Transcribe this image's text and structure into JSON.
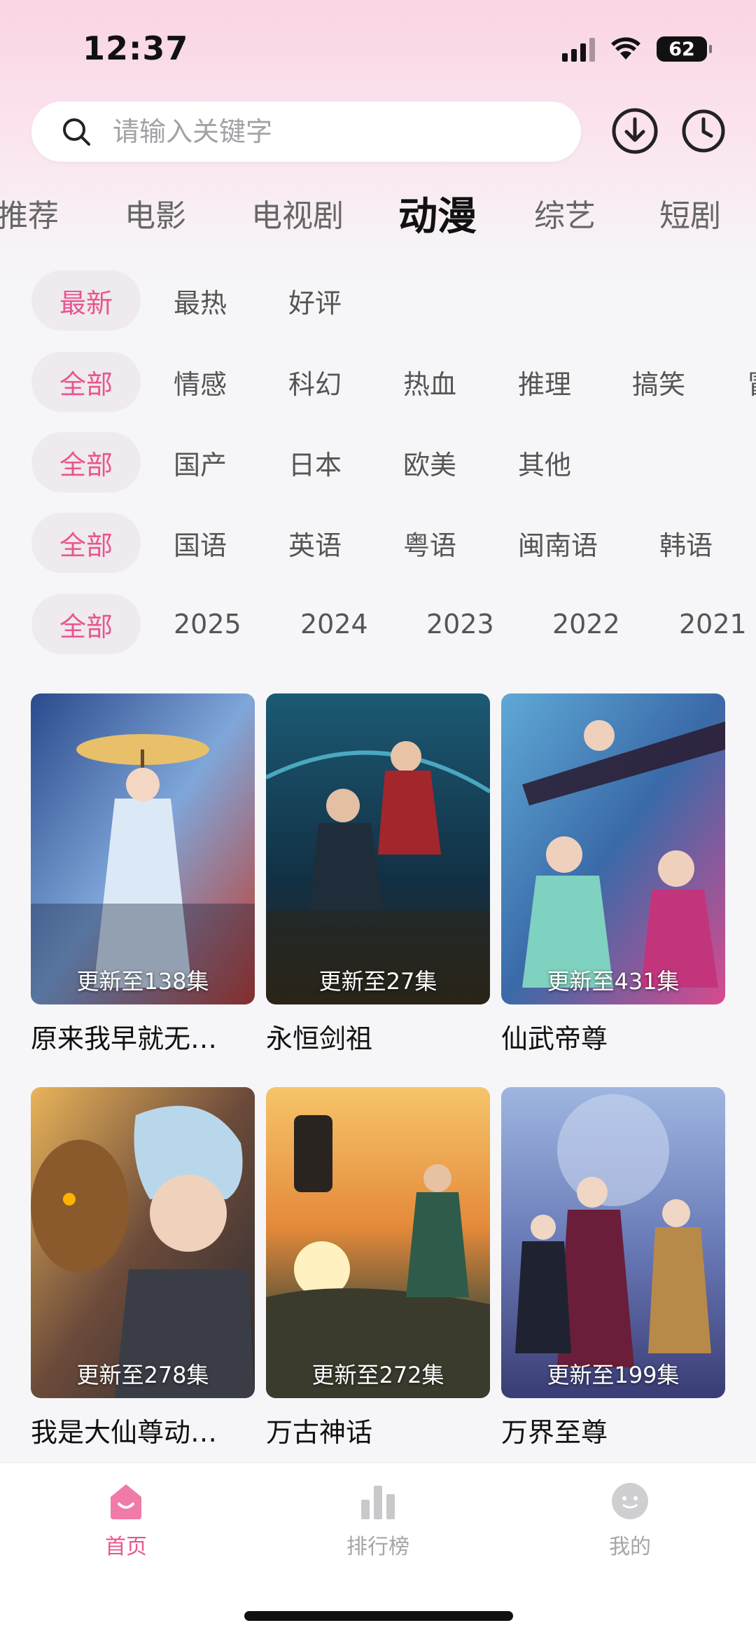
{
  "status": {
    "time": "12:37",
    "battery": "62"
  },
  "search": {
    "placeholder": "请输入关键字"
  },
  "category_tabs": [
    "推荐",
    "电影",
    "电视剧",
    "动漫",
    "综艺",
    "短剧"
  ],
  "active_category": "动漫",
  "filters": {
    "sort": [
      "最新",
      "最热",
      "好评"
    ],
    "genre": [
      "全部",
      "情感",
      "科幻",
      "热血",
      "推理",
      "搞笑",
      "冒"
    ],
    "region": [
      "全部",
      "国产",
      "日本",
      "欧美",
      "其他"
    ],
    "language": [
      "全部",
      "国语",
      "英语",
      "粤语",
      "闽南语",
      "韩语"
    ],
    "year": [
      "全部",
      "2025",
      "2024",
      "2023",
      "2022",
      "2021"
    ]
  },
  "cards": [
    {
      "title": "原来我早就无…",
      "badge": "更新至138集"
    },
    {
      "title": "永恒剑祖",
      "badge": "更新至27集"
    },
    {
      "title": "仙武帝尊",
      "badge": "更新至431集"
    },
    {
      "title": "我是大仙尊动…",
      "badge": "更新至278集"
    },
    {
      "title": "万古神话",
      "badge": "更新至272集"
    },
    {
      "title": "万界至尊",
      "badge": "更新至199集"
    }
  ],
  "nav": {
    "home": "首页",
    "ranking": "排行榜",
    "mine": "我的"
  },
  "colors": {
    "accent": "#e9558f",
    "chip_bg": "#eeeaee",
    "header_pink": "#f9d4e4"
  },
  "icons": [
    "search-icon",
    "download-icon",
    "history-icon",
    "home-icon",
    "ranking-icon",
    "profile-icon"
  ]
}
